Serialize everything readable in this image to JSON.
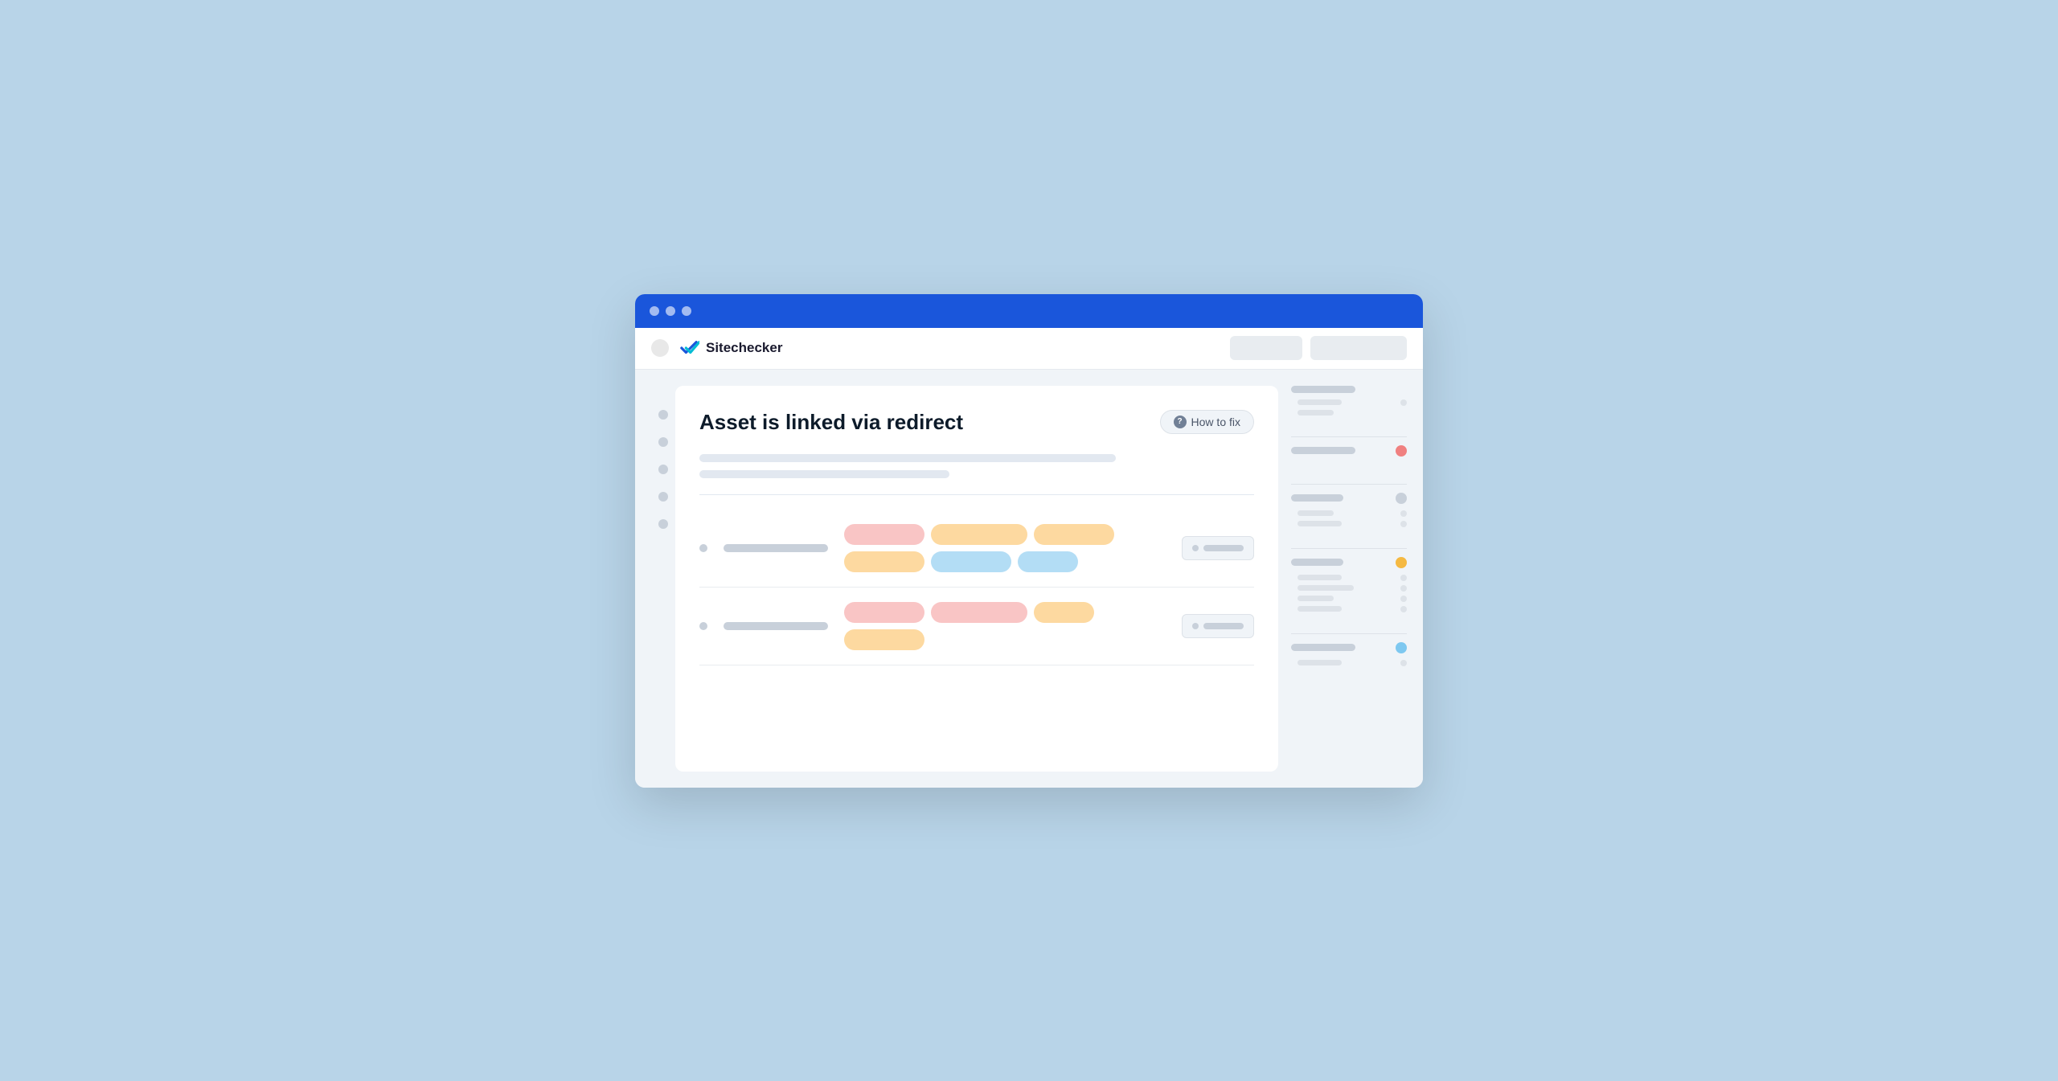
{
  "browser": {
    "titlebar": {
      "dots": [
        "dot1",
        "dot2",
        "dot3"
      ]
    },
    "toolbar": {
      "logo_text": "Sitechecker",
      "btn1_label": "",
      "btn2_label": ""
    }
  },
  "page": {
    "title": "Asset is linked via redirect",
    "how_to_fix_label": "How to fix",
    "description_line1": "",
    "description_line2": ""
  },
  "table": {
    "rows": [
      {
        "id": "row1",
        "tags": [
          {
            "color": "pink",
            "size": "md"
          },
          {
            "color": "orange",
            "size": "lg"
          },
          {
            "color": "orange",
            "size": "md"
          },
          {
            "color": "orange",
            "size": "md"
          },
          {
            "color": "blue",
            "size": "md"
          },
          {
            "color": "blue",
            "size": "sm"
          }
        ]
      },
      {
        "id": "row2",
        "tags": [
          {
            "color": "pink",
            "size": "md"
          },
          {
            "color": "pink",
            "size": "lg"
          },
          {
            "color": "orange",
            "size": "md"
          },
          {
            "color": "orange",
            "size": "md"
          }
        ]
      }
    ]
  },
  "right_sidebar": {
    "groups": [
      {
        "main_bar": "lg",
        "indicator": "none",
        "sub_items": [
          {
            "bar": "md",
            "dot": true
          },
          {
            "bar": "sm",
            "dot": false
          }
        ]
      },
      {
        "main_bar": "lg",
        "indicator": "red",
        "sub_items": []
      },
      {
        "main_bar": "md",
        "indicator": "none",
        "sub_items": [
          {
            "bar": "sm",
            "dot": true
          },
          {
            "bar": "md",
            "dot": true
          }
        ]
      },
      {
        "main_bar": "md",
        "indicator": "orange",
        "sub_items": [
          {
            "bar": "md",
            "dot": true
          },
          {
            "bar": "lg",
            "dot": true
          },
          {
            "bar": "sm",
            "dot": true
          },
          {
            "bar": "md",
            "dot": true
          }
        ]
      },
      {
        "main_bar": "lg",
        "indicator": "blue",
        "sub_items": [
          {
            "bar": "md",
            "dot": true
          }
        ]
      }
    ]
  }
}
